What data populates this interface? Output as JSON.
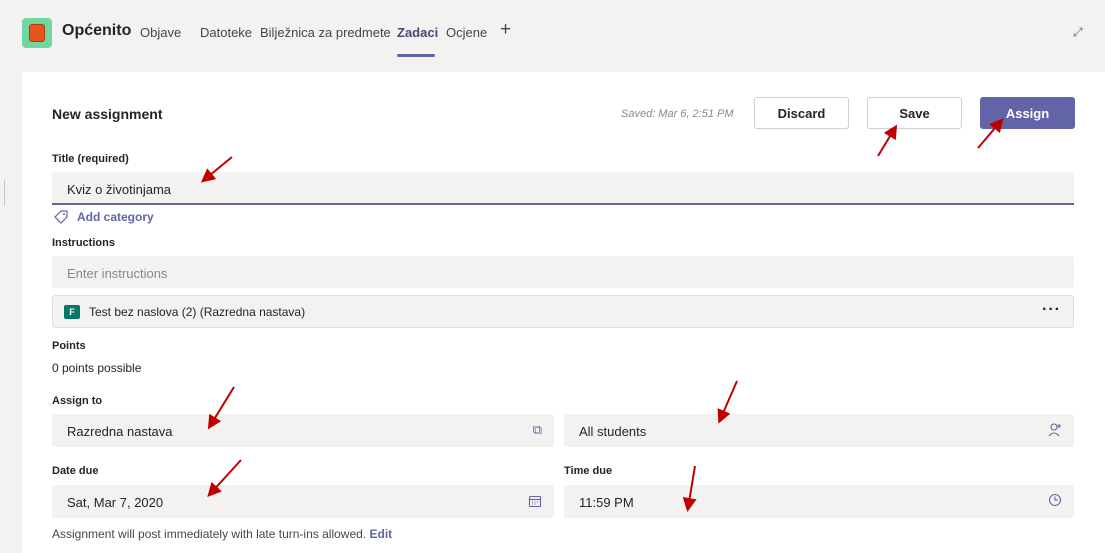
{
  "header": {
    "channel_name": "Općenito",
    "tabs": [
      {
        "label": "Objave"
      },
      {
        "label": "Datoteke"
      },
      {
        "label": "Bilježnica za predmete"
      },
      {
        "label": "Zadaci",
        "active": true
      },
      {
        "label": "Ocjene"
      }
    ],
    "add_tab_icon": "+"
  },
  "form": {
    "title": "New assignment",
    "saved_text": "Saved: Mar 6, 2:51 PM",
    "discard_label": "Discard",
    "save_label": "Save",
    "assign_label": "Assign",
    "title_label": "Title (required)",
    "title_value": "Kviz o životinjama",
    "add_category": "Add category",
    "instructions_label": "Instructions",
    "instructions_placeholder": "Enter instructions",
    "attachment_name": "Test bez naslova (2) (Razredna nastava)",
    "points_label": "Points",
    "points_value": "0 points possible",
    "assign_to_label": "Assign to",
    "assign_to_value": "Razredna nastava",
    "students_value": "All students",
    "date_due_label": "Date due",
    "date_due_value": "Sat, Mar 7, 2020",
    "time_due_label": "Time due",
    "time_due_value": "11:59 PM",
    "footer_note": "Assignment will post immediately with late turn-ins allowed.",
    "footer_edit": "Edit"
  },
  "colors": {
    "accent": "#6264a7",
    "annotation_arrow": "#c00000"
  },
  "icons": [
    "expand-icon",
    "tag-icon",
    "forms-icon",
    "more-icon",
    "class-icon",
    "add-student-icon",
    "calendar-icon",
    "clock-icon"
  ]
}
